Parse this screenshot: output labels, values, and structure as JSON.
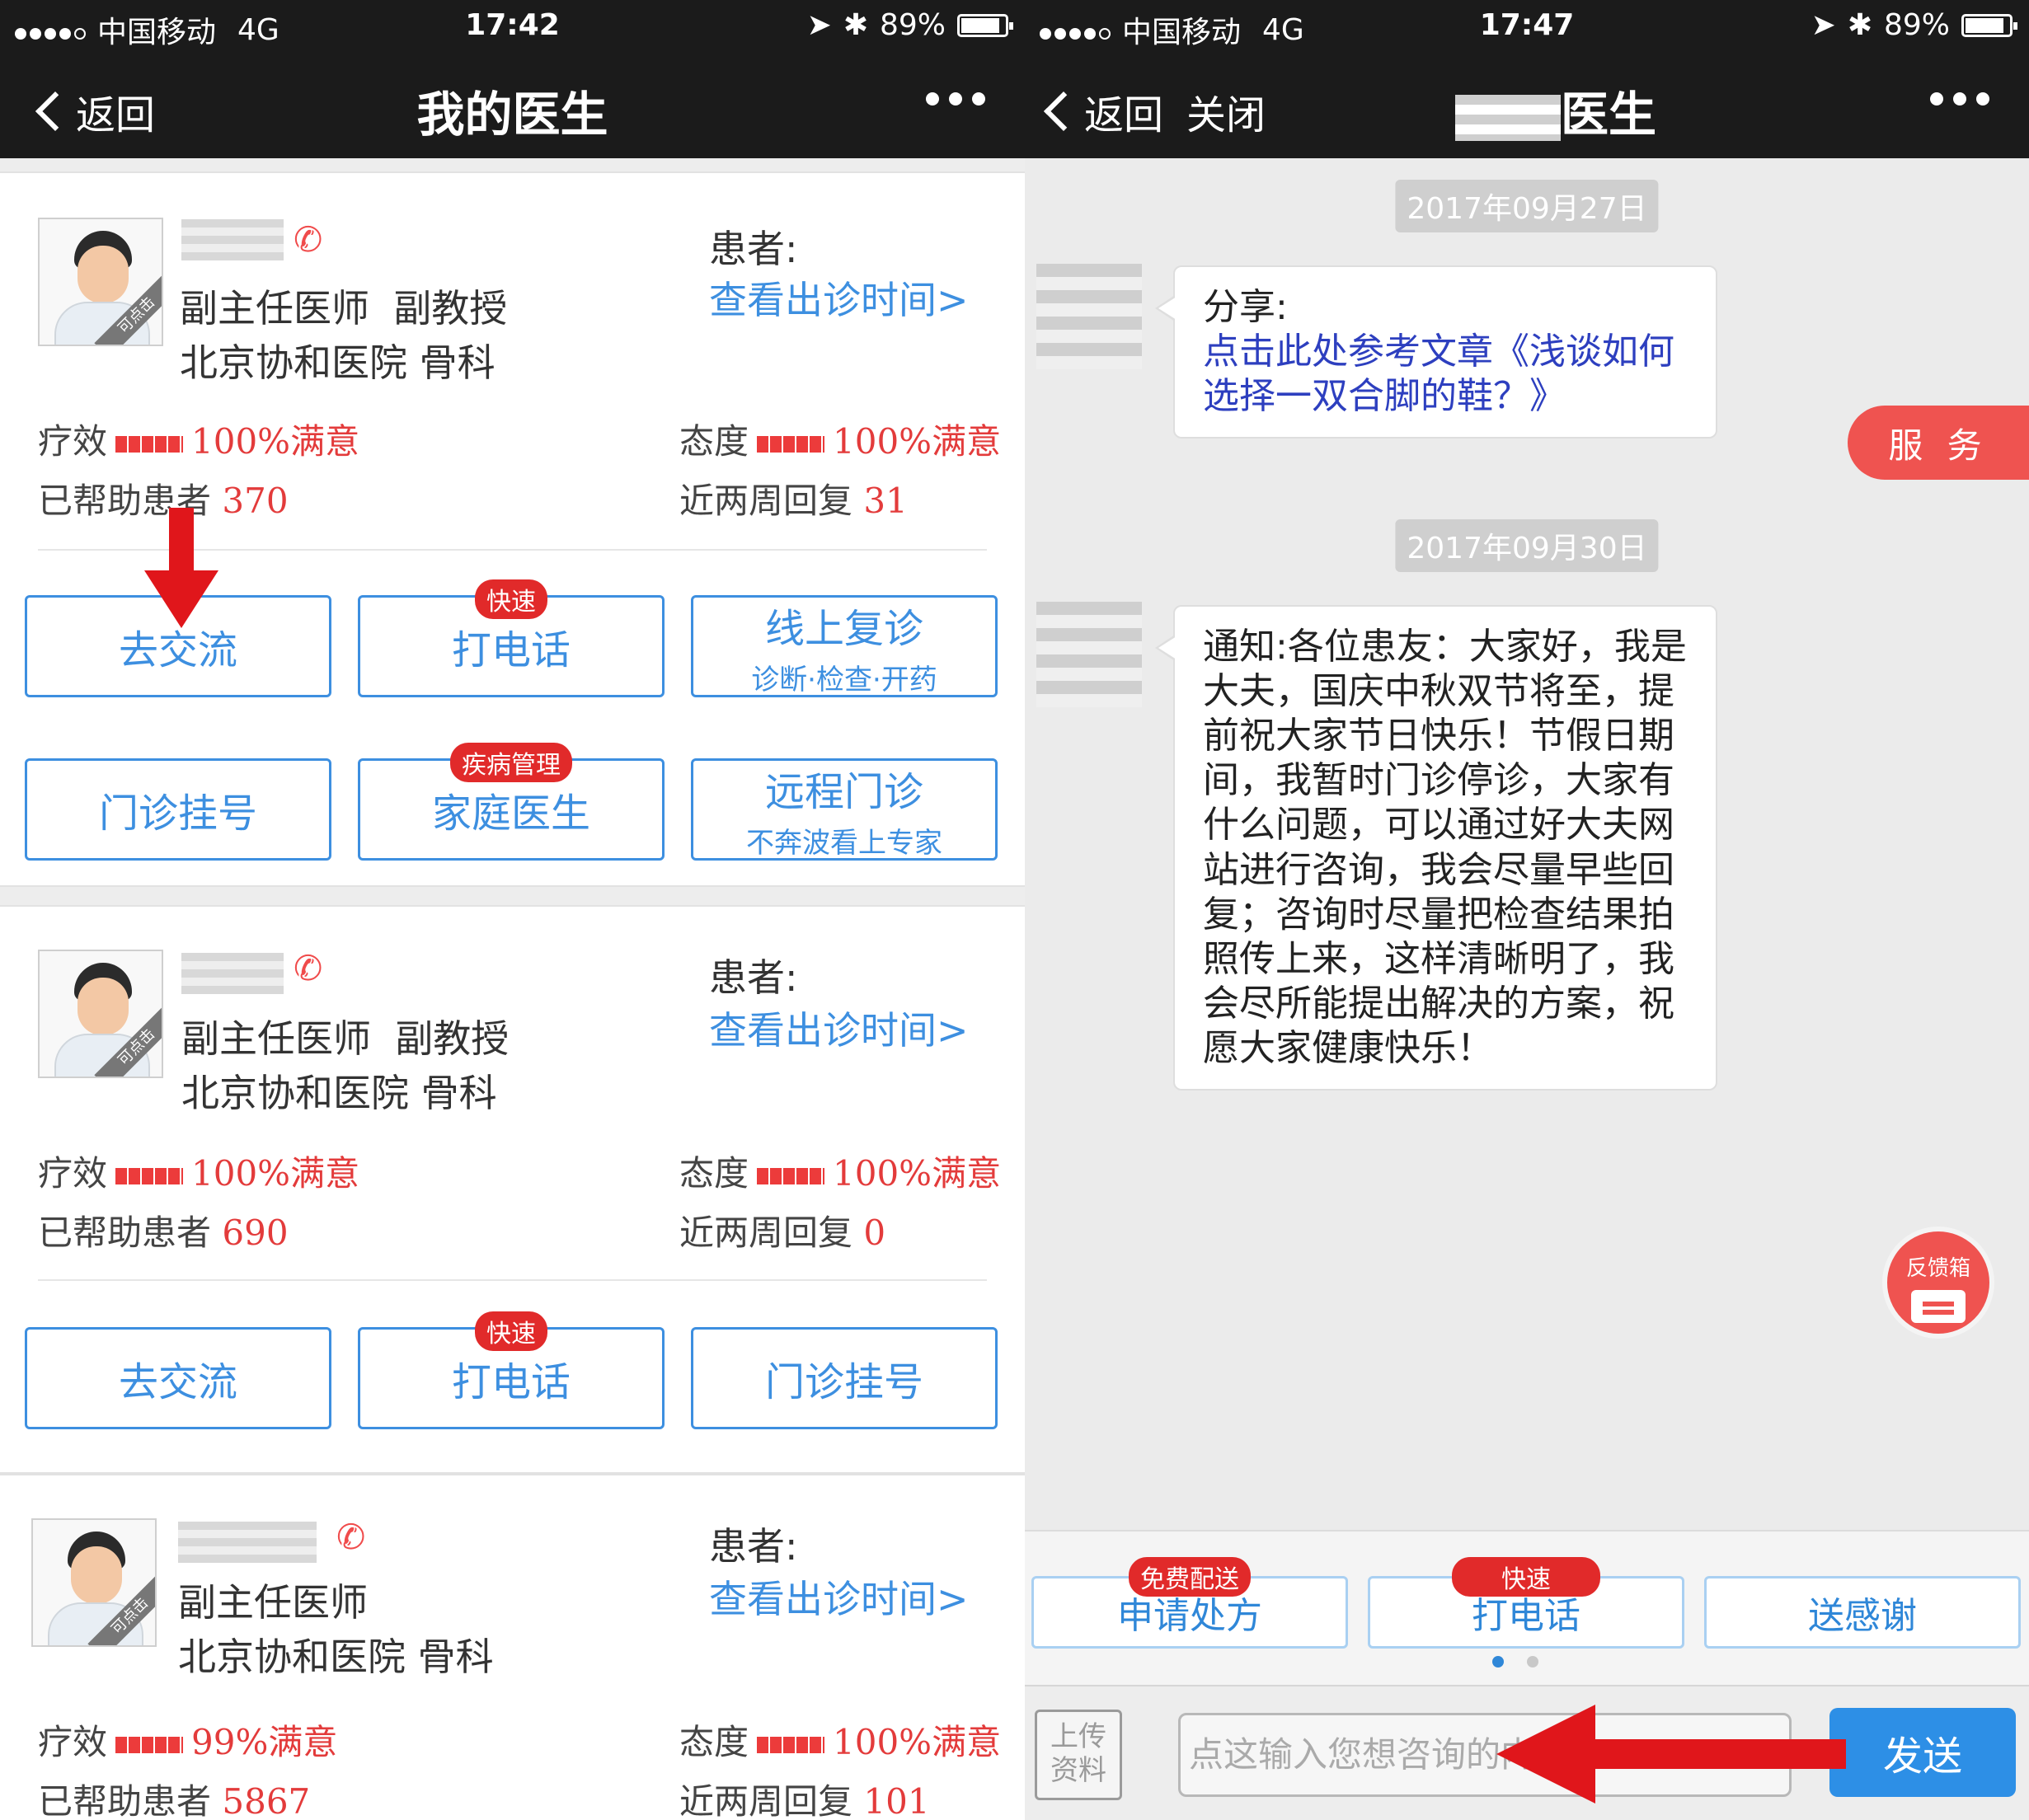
{
  "left_screen": {
    "status": {
      "carrier": "中国移动",
      "network": "4G",
      "time": "17:42",
      "battery": "89%"
    },
    "nav": {
      "back": "返回",
      "title": "我的医生"
    },
    "doctors": [
      {
        "title": "副主任医师  副教授",
        "hospital": "北京协和医院 骨科",
        "patient_label": "患者:",
        "schedule_link": "查看出诊时间>",
        "efficacy_label": "疗效",
        "efficacy_value": "100%满意",
        "attitude_label": "态度",
        "attitude_value": "100%满意",
        "helped_label": "已帮助患者",
        "helped_value": "370",
        "reply_label": "近两周回复",
        "reply_value": "31",
        "buttons": [
          {
            "label": "去交流",
            "sub": "",
            "tag": ""
          },
          {
            "label": "打电话",
            "sub": "",
            "tag": "快速"
          },
          {
            "label": "线上复诊",
            "sub": "诊断·检查·开药",
            "tag": ""
          },
          {
            "label": "门诊挂号",
            "sub": "",
            "tag": ""
          },
          {
            "label": "家庭医生",
            "sub": "",
            "tag": "疾病管理"
          },
          {
            "label": "远程门诊",
            "sub": "不奔波看上专家",
            "tag": ""
          }
        ]
      },
      {
        "title": "副主任医师  副教授",
        "hospital": "北京协和医院 骨科",
        "patient_label": "患者:",
        "schedule_link": "查看出诊时间>",
        "efficacy_label": "疗效",
        "efficacy_value": "100%满意",
        "attitude_label": "态度",
        "attitude_value": "100%满意",
        "helped_label": "已帮助患者",
        "helped_value": "690",
        "reply_label": "近两周回复",
        "reply_value": "0",
        "buttons": [
          {
            "label": "去交流",
            "sub": "",
            "tag": ""
          },
          {
            "label": "打电话",
            "sub": "",
            "tag": "快速"
          },
          {
            "label": "门诊挂号",
            "sub": "",
            "tag": ""
          }
        ]
      },
      {
        "title": "副主任医师",
        "hospital": "北京协和医院 骨科",
        "patient_label": "患者:",
        "schedule_link": "查看出诊时间>",
        "efficacy_label": "疗效",
        "efficacy_value": "99%满意",
        "attitude_label": "态度",
        "attitude_value": "100%满意",
        "helped_label": "已帮助患者",
        "helped_value": "5867",
        "reply_label": "近两周回复",
        "reply_value": "101"
      }
    ],
    "avatar_ribbon": "可点击"
  },
  "right_screen": {
    "status": {
      "carrier": "中国移动",
      "network": "4G",
      "time": "17:47",
      "battery": "89%"
    },
    "nav": {
      "back": "返回",
      "close": "关闭",
      "title": "医生"
    },
    "messages": [
      {
        "date": "2017年09月27日",
        "prefix": "分享:",
        "link": "点击此处参考文章《浅谈如何选择一双合脚的鞋？》"
      },
      {
        "date": "2017年09月30日",
        "text": "通知:各位患友：大家好，我是大夫，国庆中秋双节将至，提前祝大家节日快乐！节假日期间，我暂时门诊停诊，大家有什么问题，可以通过好大夫网站进行咨询，我会尽量早些回复；咨询时尽量把检查结果拍照传上来，这样清晰明了，我会尽所能提出解决的方案，祝愿大家健康快乐！"
      }
    ],
    "service_tab": "服 务",
    "feedback": "反馈箱",
    "actions": [
      {
        "label": "申请处方",
        "tag": "免费配送"
      },
      {
        "label": "打电话",
        "tag": "快速"
      },
      {
        "label": "送感谢",
        "tag": ""
      }
    ],
    "upload": "上传资料",
    "input_placeholder": "点这输入您想咨询的内容",
    "send": "发送"
  },
  "colors": {
    "accent_blue": "#3d8fe0",
    "tag_red": "#e12a2a",
    "nav_dark": "#1b1b1b",
    "arrow_red": "#e0161b"
  }
}
